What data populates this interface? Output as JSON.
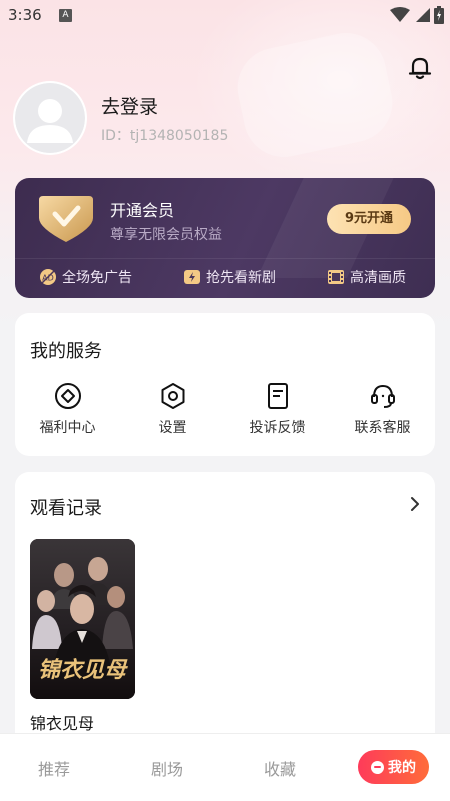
{
  "status_bar": {
    "time": "3:36",
    "a_badge": "A"
  },
  "profile": {
    "login_text": "去登录",
    "user_id": "ID：tj1348050185"
  },
  "vip": {
    "title": "开通会员",
    "subtitle": "尊享无限会员权益",
    "button_label": "9元开通",
    "perks": [
      "全场免广告",
      "抢先看新剧",
      "高清画质"
    ]
  },
  "services": {
    "title": "我的服务",
    "items": [
      {
        "label": "福利中心",
        "icon": "gift-diamond-icon"
      },
      {
        "label": "设置",
        "icon": "settings-hex-icon"
      },
      {
        "label": "投诉反馈",
        "icon": "feedback-doc-icon"
      },
      {
        "label": "联系客服",
        "icon": "headset-icon"
      }
    ]
  },
  "history": {
    "title": "观看记录",
    "items": [
      {
        "title": "锦衣见母",
        "poster_text": "锦衣见母"
      }
    ]
  },
  "bottom_nav": {
    "items": [
      "推荐",
      "剧场",
      "收藏"
    ],
    "active": "我的"
  },
  "colors": {
    "accent": "#fe3b5a",
    "vip_card": "#463456",
    "vip_button": "#f9d49a"
  }
}
